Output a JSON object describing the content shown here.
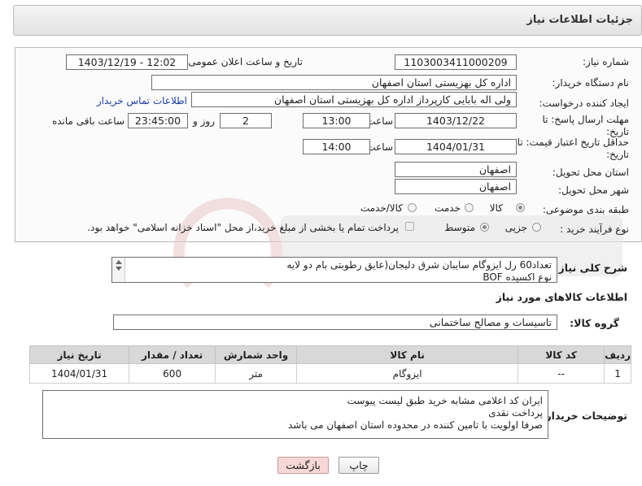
{
  "header": {
    "title": "جزئیات اطلاعات نیاز"
  },
  "form": {
    "need_number_label": "شماره نیاز:",
    "need_number": "1103003411000209",
    "announce_label": "تاریخ و ساعت اعلان عمومی:",
    "announce_value": "1403/12/19 - 12:02",
    "buyer_org_label": "نام دستگاه خریدار:",
    "buyer_org": "اداره کل بهزیستی استان اصفهان",
    "creator_label": "ایجاد کننده درخواست:",
    "creator": "ولی اله بابایی کارپرداز اداره کل بهزیستی استان اصفهان",
    "contact_link": "اطلاعات تماس خریدار",
    "reply_deadline_label_1": "مهلت ارسال پاسخ: تا",
    "reply_deadline_label_2": "تاریخ:",
    "reply_date": "1403/12/22",
    "time_label": "ساعت",
    "reply_time": "13:00",
    "days_value": "2",
    "days_label": "روز و",
    "remaining_value": "23:45:00",
    "remaining_label": "ساعت باقی مانده",
    "validity_label_1": "حداقل تاریخ اعتبار قیمت: تا",
    "validity_label_2": "تاریخ:",
    "validity_date": "1404/01/31",
    "validity_time_label": "ساعت",
    "validity_time": "14:00",
    "province_label": "استان محل تحویل:",
    "province": "اصفهان",
    "city_label": "شهر محل تحویل:",
    "city": "اصفهان",
    "category_label": "طبقه بندی موضوعی:",
    "category_options": [
      "کالا",
      "خدمت",
      "کالا/خدمت"
    ],
    "category_selected": "کالا",
    "process_label": "نوع فرآیند خرید :",
    "process_options": [
      "جزیی",
      "متوسط"
    ],
    "process_selected": "جزیی",
    "payment_note": "پرداخت تمام یا بخشی از مبلغ خرید،از محل \"اسناد خزانه اسلامی\" خواهد بود."
  },
  "description": {
    "label": "شرح کلی نیاز:",
    "line1": "تعداد60 رل ایزوگام سایبان شرق دلیجان(عایق رطوبتی بام دو لایه",
    "line2": "نوع اکسیده BOF"
  },
  "goods_info": {
    "title": "اطلاعات کالاهای مورد نیاز",
    "group_label": "گروه کالا:",
    "group_value": "تاسیسات و مصالح ساختمانی"
  },
  "table": {
    "headers": [
      "ردیف",
      "کد کالا",
      "نام کالا",
      "واحد شمارش",
      "تعداد / مقدار",
      "تاریخ نیاز"
    ],
    "rows": [
      {
        "row": "1",
        "code": "--",
        "name": "ایزوگام",
        "unit": "متر",
        "qty": "600",
        "date": "1404/01/31"
      }
    ]
  },
  "buyer_notes": {
    "label": "توضیحات خریدار:",
    "line1": "ایران کد اعلامی مشابه خرید طبق لیست پیوست",
    "line2": "پرداخت نقدی",
    "line3": "صرفا اولویت با تامین کننده در محدوده استان اصفهان می  باشد"
  },
  "buttons": {
    "print": "چاپ",
    "back": "بازگشت"
  },
  "colors": {
    "link": "#1a3fa8",
    "back_button": "#f8d7d7",
    "header_bg": "#e9e9e9"
  }
}
